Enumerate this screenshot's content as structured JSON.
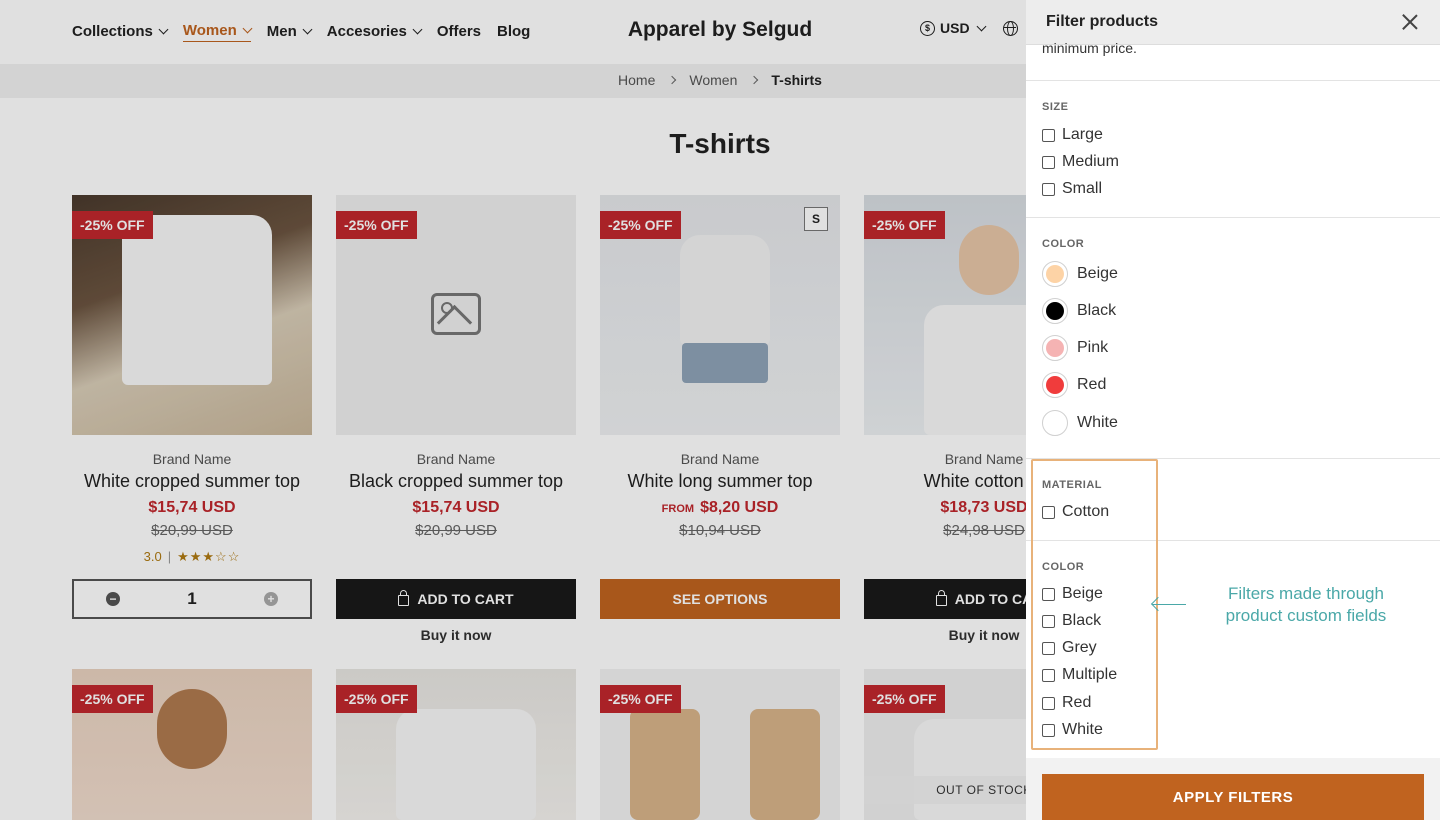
{
  "store": {
    "nav": [
      {
        "label": "Collections",
        "dropdown": true,
        "active": false
      },
      {
        "label": "Women",
        "dropdown": true,
        "active": true
      },
      {
        "label": "Men",
        "dropdown": true,
        "active": false
      },
      {
        "label": "Accesories",
        "dropdown": true,
        "active": false
      },
      {
        "label": "Offers",
        "dropdown": false,
        "active": false
      },
      {
        "label": "Blog",
        "dropdown": false,
        "active": false
      }
    ],
    "brand": "Apparel by Selgud",
    "currency": "USD",
    "breadcrumb": [
      "Home",
      "Women",
      "T-shirts"
    ],
    "page_title": "T-shirts",
    "products": [
      {
        "badge": "-25% OFF",
        "brand": "Brand Name",
        "name": "White cropped summer top",
        "price": "$15,74 USD",
        "old_price": "$20,99 USD",
        "rating": "3.0",
        "stars": "★★★☆☆",
        "quantity": "1"
      },
      {
        "badge": "-25% OFF",
        "brand": "Brand Name",
        "name": "Black cropped summer top",
        "price": "$15,74 USD",
        "old_price": "$20,99 USD",
        "button": "ADD TO CART",
        "buy_now": "Buy it now"
      },
      {
        "badge": "-25% OFF",
        "size_tag": "S",
        "brand": "Brand Name",
        "name": "White long summer top",
        "price_prefix": "FROM",
        "price": "$8,20 USD",
        "old_price": "$10,94 USD",
        "button": "SEE OPTIONS"
      },
      {
        "badge": "-25% OFF",
        "brand": "Brand Name",
        "name": "White cotton T-",
        "price": "$18,73 USD",
        "old_price": "$24,98 USD",
        "button": "ADD TO CA",
        "buy_now": "Buy it now"
      }
    ],
    "row2_badges": [
      "-25% OFF",
      "-25% OFF",
      "-25% OFF",
      "-25% OFF"
    ],
    "out_of_stock": "OUT OF STOCK"
  },
  "drawer": {
    "title": "Filter products",
    "truncated_text": "minimum price.",
    "size": {
      "title": "SIZE",
      "options": [
        "Large",
        "Medium",
        "Small"
      ]
    },
    "color_swatches": {
      "title": "COLOR",
      "options": [
        {
          "label": "Beige",
          "color": "#fdd3a6"
        },
        {
          "label": "Black",
          "color": "#000000"
        },
        {
          "label": "Pink",
          "color": "#f5b3b3"
        },
        {
          "label": "Red",
          "color": "#f03c3c"
        },
        {
          "label": "White",
          "color": "#ffffff"
        }
      ]
    },
    "material": {
      "title": "MATERIAL",
      "options": [
        "Cotton"
      ]
    },
    "color_custom": {
      "title": "COLOR",
      "options": [
        "Beige",
        "Black",
        "Grey",
        "Multiple",
        "Red",
        "White"
      ]
    },
    "apply_label": "APPLY FILTERS"
  },
  "annotation": {
    "line1": "Filters made through",
    "line2": "product custom fields",
    "color": "#4aa8a8"
  },
  "colors": {
    "accent": "#c0631f",
    "sale": "#c1272d",
    "highlight": "#e8b27a"
  }
}
